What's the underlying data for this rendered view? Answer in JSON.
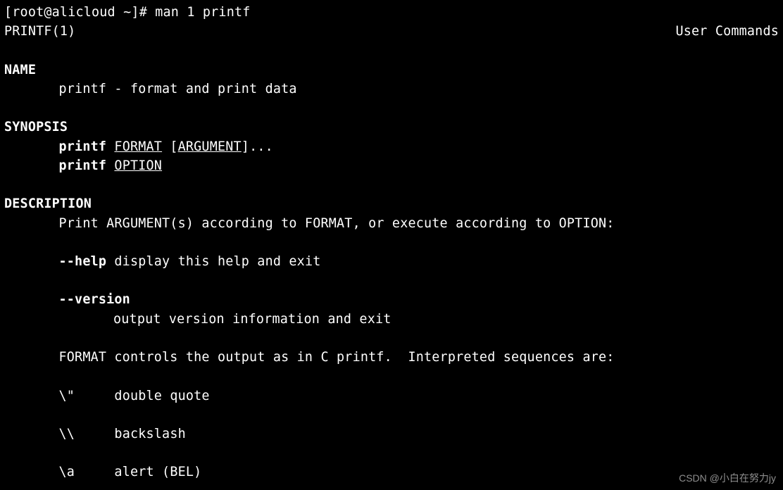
{
  "prompt": {
    "user": "root",
    "host": "alicloud",
    "cwd": "~",
    "symbol": "#",
    "command": "man 1 printf"
  },
  "header": {
    "left": "PRINTF(1)",
    "center": "User Commands"
  },
  "sections": {
    "name": {
      "title": "NAME",
      "text": "printf - format and print data"
    },
    "synopsis": {
      "title": "SYNOPSIS",
      "line1_cmd": "printf",
      "line1_format": "FORMAT",
      "line1_open": " [",
      "line1_arg": "ARGUMENT",
      "line1_close": "]...",
      "line2_cmd": "printf",
      "line2_option": "OPTION"
    },
    "description": {
      "title": "DESCRIPTION",
      "intro": "Print ARGUMENT(s) according to FORMAT, or execute according to OPTION:",
      "help_flag": "--help",
      "help_text": " display this help and exit",
      "version_flag": "--version",
      "version_text": "output version information and exit",
      "format_text": "FORMAT controls the output as in C printf.  Interpreted sequences are:",
      "seq1_key": "\\\"",
      "seq1_val": "double quote",
      "seq2_key": "\\\\",
      "seq2_val": "backslash",
      "seq3_key": "\\a",
      "seq3_val": "alert (BEL)"
    }
  },
  "watermark": "CSDN @小白在努力jy"
}
